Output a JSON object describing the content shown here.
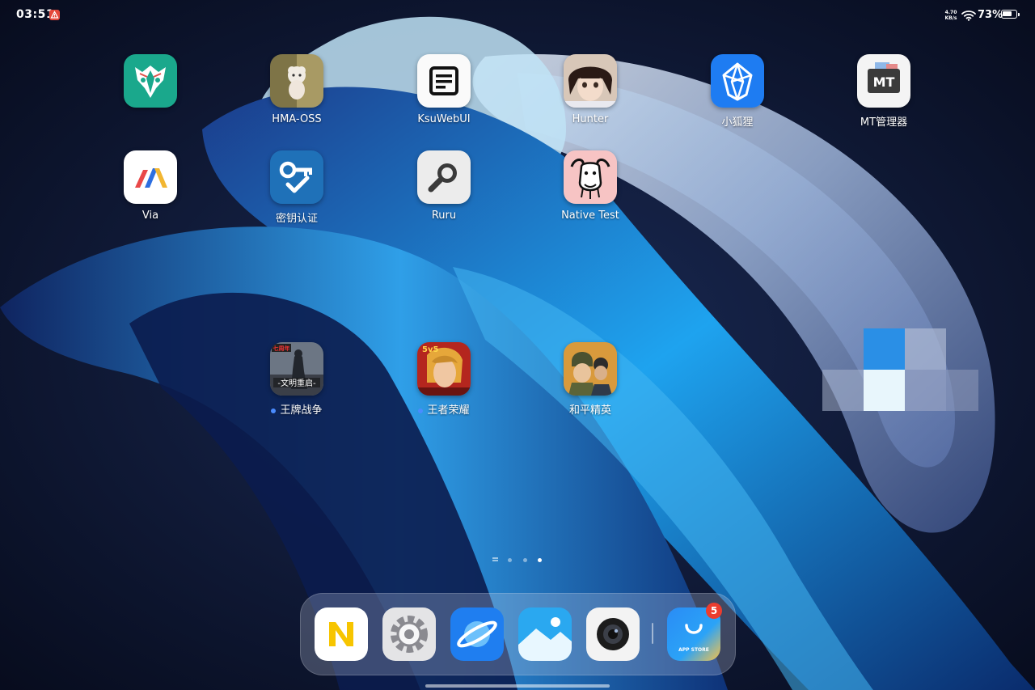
{
  "status_bar": {
    "time": "03:51",
    "net_speed_value": "4.70",
    "net_speed_unit": "KB/s",
    "battery_percent": "73%",
    "battery_level": 0.73
  },
  "apps": [
    {
      "label": "",
      "icon": "magisk-mask-icon"
    },
    {
      "label": "HMA-OSS",
      "icon": "hma-sheep-icon"
    },
    {
      "label": "KsuWebUI",
      "icon": "webui-window-icon"
    },
    {
      "label": "Hunter",
      "icon": "hunter-avatar-icon"
    },
    {
      "label": "小狐狸",
      "icon": "fox-logo-icon"
    },
    {
      "label": "MT管理器",
      "icon": "mt-manager-icon"
    },
    {
      "label": "Via",
      "icon": "via-browser-icon"
    },
    {
      "label": "密钥认证",
      "icon": "key-check-icon"
    },
    {
      "label": "Ruru",
      "icon": "magnifier-icon"
    },
    {
      "label": "Native Test",
      "icon": "gnu-head-icon"
    },
    {
      "label": "王牌战争",
      "icon": "game-soldier-icon",
      "badge_text": "七周年",
      "banner_text": "-文明重启-"
    },
    {
      "label": "王者荣耀",
      "icon": "game-hero-icon",
      "badge_text": "5v5"
    },
    {
      "label": "和平精英",
      "icon": "game-helmet-icon"
    }
  ],
  "dock": {
    "apps": [
      {
        "icon": "notes-n-icon"
      },
      {
        "icon": "settings-gear-icon"
      },
      {
        "icon": "browser-planet-icon"
      },
      {
        "icon": "gallery-icon"
      },
      {
        "icon": "camera-icon"
      },
      {
        "icon": "app-store-bag-icon",
        "label": "APP STORE"
      }
    ],
    "app_store_badge": "5"
  },
  "pager": {
    "pages": 3,
    "active_index": 2
  },
  "colors": {
    "accent_blue": "#1e7cf2",
    "magisk_teal": "#1aa88c",
    "badge_red": "#ec3d2f"
  }
}
